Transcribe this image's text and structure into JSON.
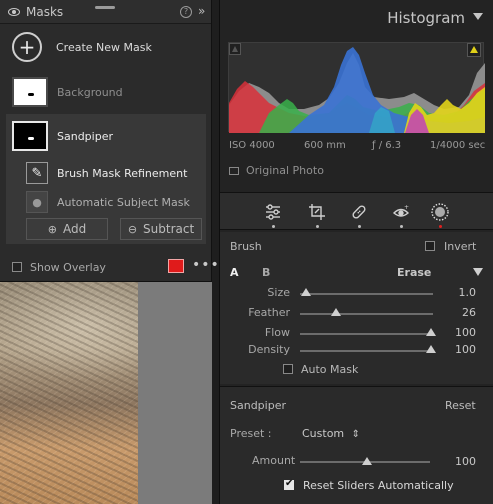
{
  "masks_panel": {
    "title": "Masks",
    "help_label": "?",
    "collapse_label": "»",
    "create_label": "Create New Mask",
    "background_label": "Background",
    "sandpiper_label": "Sandpiper",
    "brush_refine_label": "Brush Mask Refinement",
    "auto_subject_label": "Automatic Subject Mask",
    "add_label": "Add",
    "subtract_label": "Subtract",
    "show_overlay_label": "Show Overlay",
    "overlay_color": "#e01b1b",
    "more_label": "•••"
  },
  "histogram": {
    "title": "Histogram",
    "iso": "ISO 4000",
    "focal": "600 mm",
    "aperture": "ƒ / 6.3",
    "shutter": "1/4000 sec",
    "original_photo_label": "Original Photo"
  },
  "brush": {
    "label": "Brush",
    "invert_label": "Invert",
    "tab_a": "A",
    "tab_b": "B",
    "erase_label": "Erase",
    "sliders": [
      {
        "label": "Size",
        "value": "1.0",
        "fraction": 0.03
      },
      {
        "label": "Feather",
        "value": "26",
        "fraction": 0.26
      },
      {
        "label": "Flow",
        "value": "100",
        "fraction": 1.0
      },
      {
        "label": "Density",
        "value": "100",
        "fraction": 1.0
      }
    ],
    "auto_mask_label": "Auto Mask"
  },
  "sandpiper_section": {
    "title": "Sandpiper",
    "reset_label": "Reset",
    "preset_label": "Preset :",
    "preset_value": "Custom",
    "preset_arrows": "⇕",
    "amount_label": "Amount",
    "amount_value": "100",
    "amount_fraction": 0.5,
    "reset_sliders_label": "Reset Sliders Automatically"
  }
}
